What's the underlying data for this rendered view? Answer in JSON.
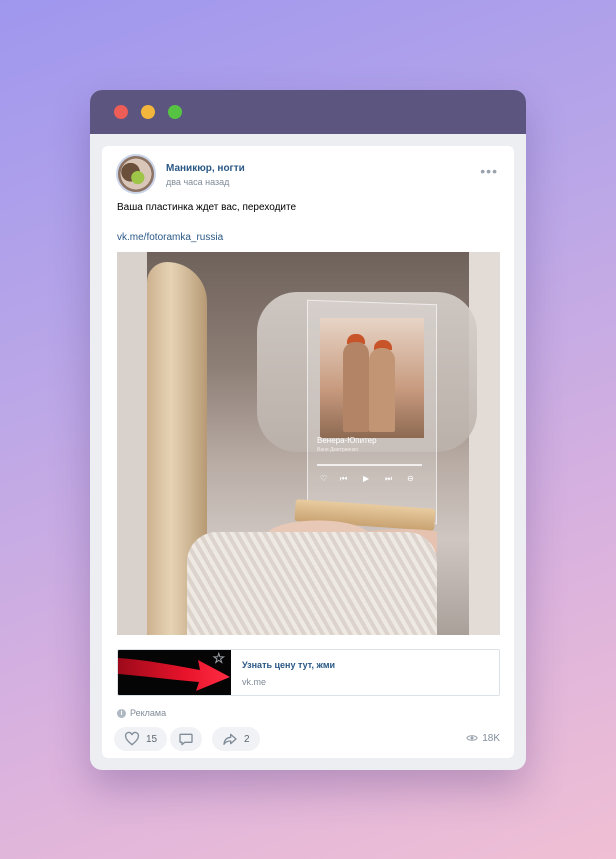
{
  "post": {
    "author": "Маникюр, ногти",
    "time": "два часа назад",
    "text": "Ваша пластинка ждет вас, переходите",
    "link": "vk.me/fotoramka_russia",
    "photo": {
      "song_title": "Венера-Юпитер",
      "song_artist": "Ваня Дмитриенко"
    }
  },
  "link_card": {
    "title": "Узнать цену тут, жми",
    "domain": "vk.me"
  },
  "ad": {
    "icon_text": "i",
    "label": "Реклама"
  },
  "actions": {
    "likes": "15",
    "shares": "2",
    "views": "18K"
  },
  "icons": {
    "more": "more-dots-icon",
    "like": "heart-icon",
    "comment": "comment-icon",
    "share": "share-icon",
    "views": "eye-icon",
    "favorite": "star-icon"
  },
  "colors": {
    "accent_link": "#2a5885",
    "secondary_text": "#818c99",
    "titlebar": "#5c5580",
    "arrow_red": "#e8132b"
  }
}
